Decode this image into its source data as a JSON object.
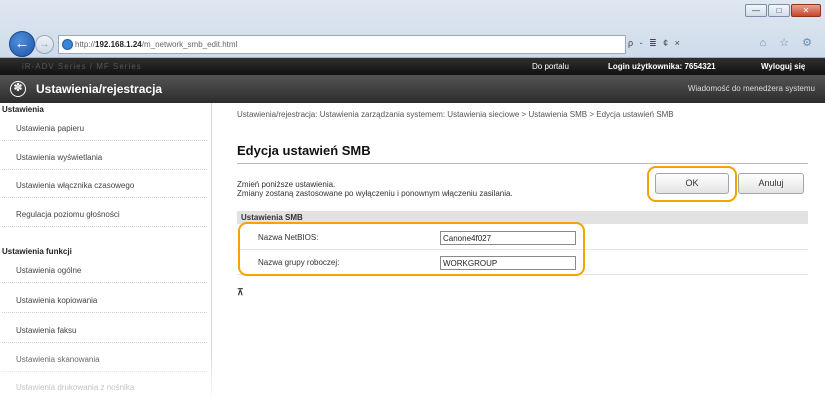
{
  "browser": {
    "url_prefix": "http://",
    "url_host": "192.168.1.24",
    "url_path": "/m_network_smb_edit.html",
    "address_tools": "ρ - ≣ ¢ ×",
    "fav_tools": "⌂ ☆ ⚙",
    "window_buttons": [
      "—",
      "□",
      "✕"
    ],
    "back_glyph": "←",
    "forward_glyph": "→"
  },
  "top_strip": {
    "product_name": "iR-ADV Series / MF Series",
    "portal_link": "Do portalu",
    "login_label": "Login użytkownika:  7654321",
    "logout_link": "Wyloguj się"
  },
  "header": {
    "title": "Ustawienia/rejestracja",
    "admin_message": "Wiadomość do menedżera systemu",
    "icon_glyph": "✽"
  },
  "sidebar": {
    "sections": [
      {
        "title": "Ustawienia",
        "items": [
          "Ustawienia papieru",
          "Ustawienia wyświetlania",
          "Ustawienia włącznika czasowego",
          "Regulacja poziomu głośności"
        ]
      },
      {
        "title": "Ustawienia funkcji",
        "items": [
          "Ustawienia ogólne",
          "Ustawienia kopiowania",
          "Ustawienia faksu",
          "Ustawienia skanowania",
          "Ustawienia drukowania z nośnika"
        ]
      }
    ]
  },
  "main": {
    "breadcrumb": "Ustawienia/rejestracja: Ustawienia zarządzania systemem: Ustawienia sieciowe > Ustawienia SMB > Edycja ustawień SMB",
    "title": "Edycja ustawień SMB",
    "instructions": [
      "Zmień poniższe ustawienia.",
      "Zmiany zostaną zastosowane po wyłączeniu i ponownym włączeniu zasilania."
    ],
    "ok_label": "OK",
    "cancel_label": "Anuluj",
    "section_title": "Ustawienia SMB",
    "fields": [
      {
        "label": "Nazwa NetBIOS:",
        "value": "Canone4f027"
      },
      {
        "label": "Nazwa grupy roboczej:",
        "value": "WORKGROUP"
      }
    ],
    "scroll_top_glyph": "⊼"
  },
  "colors": {
    "highlight": "#f4a300",
    "header_dark": "#2c2c2c"
  }
}
